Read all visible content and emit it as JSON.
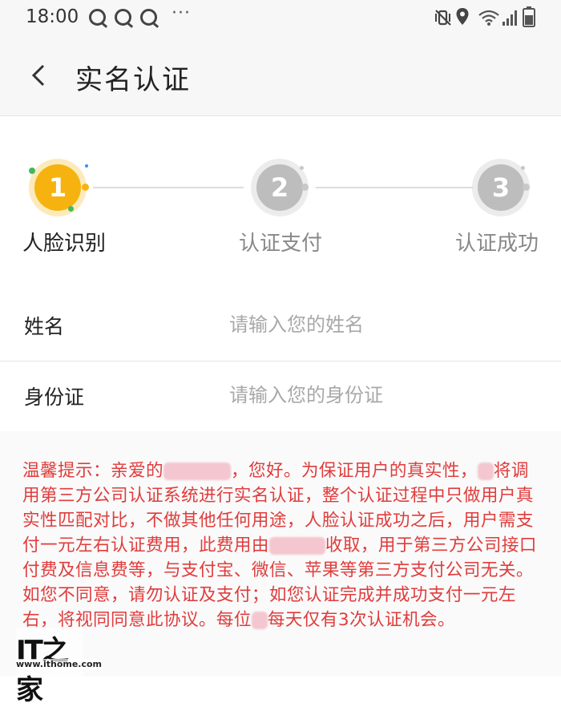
{
  "status_bar": {
    "time": "18:00",
    "dots": "···",
    "icons": [
      "q-notification-icon",
      "q-notification-icon",
      "q-notification-icon",
      "mute-vibrate-icon",
      "location-icon",
      "wifi-icon",
      "signal-icon",
      "battery-icon"
    ]
  },
  "header": {
    "title": "实名认证"
  },
  "stepper": {
    "steps": [
      {
        "number": "1",
        "label": "人脸识别",
        "state": "active"
      },
      {
        "number": "2",
        "label": "认证支付",
        "state": "inactive"
      },
      {
        "number": "3",
        "label": "认证成功",
        "state": "inactive"
      }
    ],
    "colors": {
      "active": "#f6b30f",
      "inactive": "#bdbdbd",
      "active_label": "#222222",
      "inactive_label": "#888888"
    }
  },
  "form": {
    "name": {
      "label": "姓名",
      "placeholder": "请输入您的姓名",
      "value": ""
    },
    "id_card": {
      "label": "身份证",
      "placeholder": "请输入您的身份证",
      "value": ""
    }
  },
  "notice": {
    "color": "#e03c3c",
    "lines": [
      "温馨提示：亲爱的",
      "，您好。为保证用户的真实性，",
      "将调用第三方公司认证系统进行实名认证，整个认证过程中只做用户真实性匹配对比，不做其他任何用途，人脸认证成功之后，用户需支付一元左右认证费用，此费用由",
      "收取，用于第三方公司接口付费及信息费等，与支付宝、微信、苹果等第三方支付公司无关。如您不同意，请勿认证及支付；如您认证完成并成功支付一元左右，将视同同意此协议。每位",
      "每天仅有3次认证机会。"
    ]
  },
  "watermark": {
    "logo": "IT之家",
    "url": "www.ithome.com"
  }
}
